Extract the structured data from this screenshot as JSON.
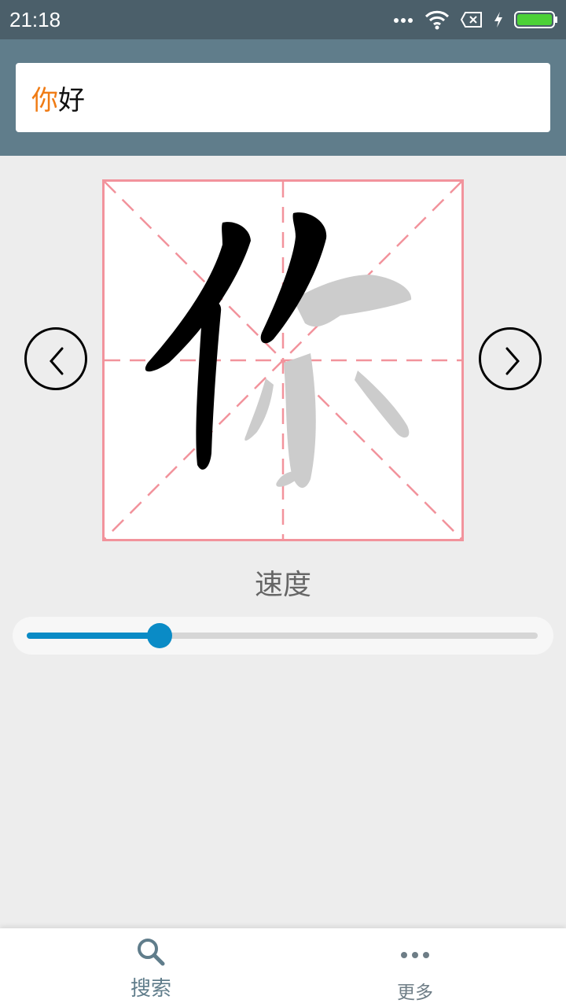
{
  "status_bar": {
    "time": "21:18",
    "icons": [
      "more-dots-icon",
      "wifi-icon",
      "sim-off-icon",
      "charging-bolt-icon",
      "battery-icon"
    ]
  },
  "search": {
    "highlight_char": "你",
    "rest_text": "好"
  },
  "board": {
    "character": "你",
    "strokes_drawn": 2,
    "guide_color": "#f2939c",
    "stroke_color": "#000000",
    "ghost_color": "#cccccc"
  },
  "nav": {
    "prev_icon": "chevron-left-icon",
    "next_icon": "chevron-right-icon"
  },
  "speed": {
    "label": "速度",
    "value_fraction": 0.26,
    "accent_color": "#0a8bc6"
  },
  "bottom_nav": {
    "tabs": [
      {
        "label": "搜索",
        "icon": "search-icon"
      },
      {
        "label": "更多",
        "icon": "more-horizontal-icon"
      }
    ]
  }
}
